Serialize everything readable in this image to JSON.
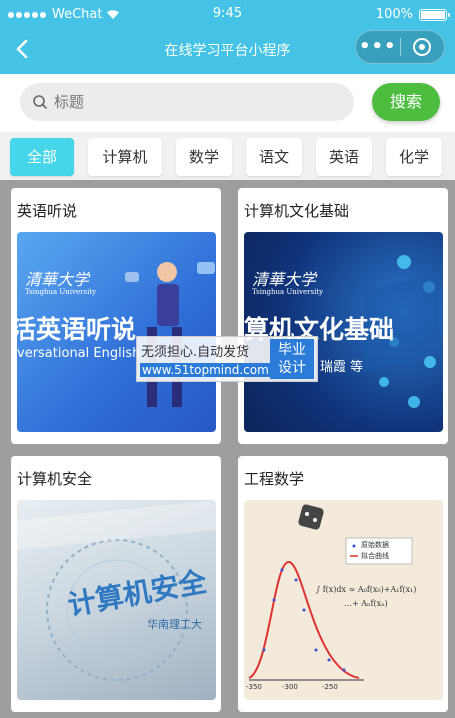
{
  "status": {
    "carrier": "WeChat",
    "time": "9:45",
    "battery": "100%"
  },
  "nav": {
    "title": "在线学习平台小程序"
  },
  "search": {
    "placeholder": "标题",
    "button": "搜索"
  },
  "tabs": [
    "全部",
    "计算机",
    "数学",
    "语文",
    "英语",
    "化学"
  ],
  "courses": [
    {
      "title": "英语听说",
      "logo": "清華大学",
      "logo_sub": "Tsinghua University",
      "cover_title": "活英语听说",
      "cover_sub": "versational English"
    },
    {
      "title": "计算机文化基础",
      "logo": "清華大学",
      "logo_sub": "Tsinghua University",
      "cover_title": "算机文化基础",
      "cover_sub": "瑞霞 等"
    },
    {
      "title": "计算机安全",
      "cover_title": "计算机安全",
      "cover_sub": "华南理工大"
    },
    {
      "title": "工程数学",
      "legend": [
        "原始数据",
        "拟合曲线"
      ],
      "axis_ticks": [
        "-350",
        "-300",
        "-250"
      ]
    }
  ],
  "watermark": {
    "line1": "无须担心.自动发货",
    "line2": "www.51topmind.com",
    "right1": "毕业",
    "right2": "设计"
  },
  "colors": {
    "header": "#45c3e6",
    "accent": "#45d6ea",
    "search_button": "#4dbd3f"
  }
}
